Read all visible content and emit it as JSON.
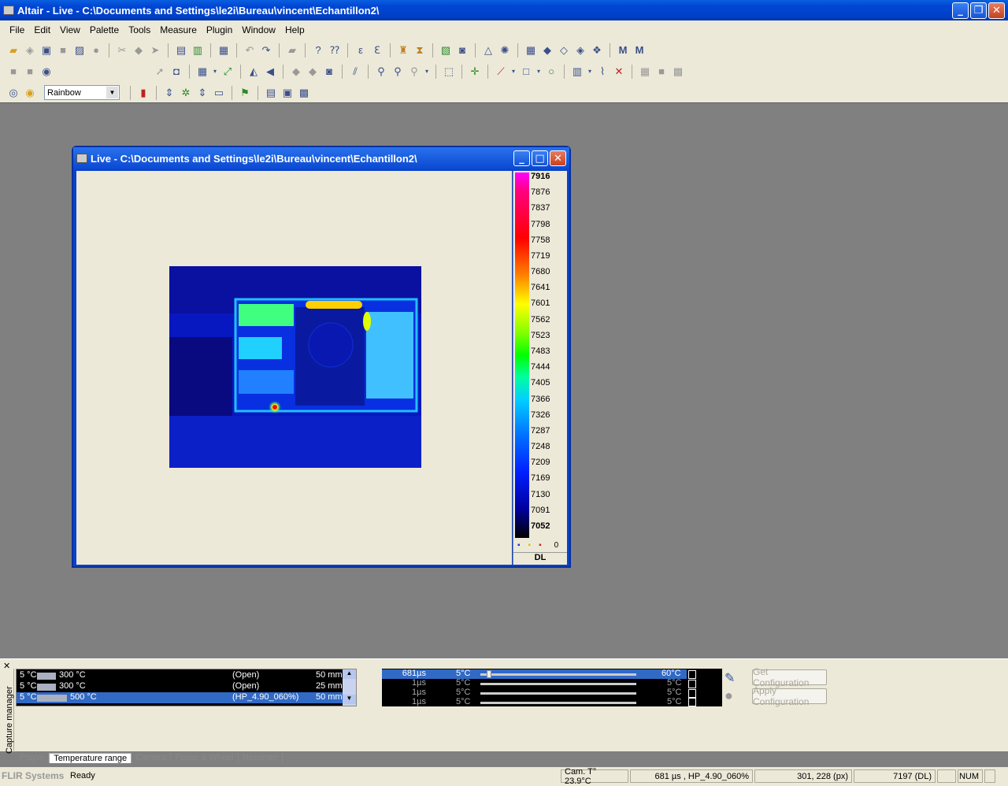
{
  "window": {
    "title": "Altair - Live - C:\\Documents and Settings\\le2i\\Bureau\\vincent\\Echantillon2\\"
  },
  "menu": [
    "File",
    "Edit",
    "View",
    "Palette",
    "Tools",
    "Measure",
    "Plugin",
    "Window",
    "Help"
  ],
  "palette": {
    "selected": "Rainbow"
  },
  "child": {
    "title": "Live - C:\\Documents and Settings\\le2i\\Bureau\\vincent\\Echantillon2\\"
  },
  "scale": {
    "ticks": [
      "7916",
      "7876",
      "7837",
      "7798",
      "7758",
      "7719",
      "7680",
      "7641",
      "7601",
      "7562",
      "7523",
      "7483",
      "7444",
      "7405",
      "7366",
      "7326",
      "7287",
      "7248",
      "7209",
      "7169",
      "7130",
      "7091",
      "7052"
    ],
    "marker_count": "0",
    "unit": "DL"
  },
  "capture": {
    "panel_label": "Capture manager",
    "ranges": [
      {
        "min": "5 °C",
        "max": "300 °C",
        "filter": "(Open)",
        "lens": "50 mm"
      },
      {
        "min": "5 °C",
        "max": "300 °C",
        "filter": "(Open)",
        "lens": "25 mm"
      },
      {
        "min": "5 °C",
        "max": "500 °C",
        "filter": "(HP_4.90_060%)",
        "lens": "50 mm"
      }
    ],
    "camera_rows": [
      {
        "time": "681µs",
        "min": "5°C",
        "max": "60°C"
      },
      {
        "time": "1µs",
        "min": "5°C",
        "max": "5°C"
      },
      {
        "time": "1µs",
        "min": "5°C",
        "max": "5°C"
      },
      {
        "time": "1µs",
        "min": "5°C",
        "max": "5°C"
      }
    ],
    "get_config": "Get Configuration",
    "apply_config": "Apply Configuration",
    "tabs": [
      "Player",
      "Temperature range",
      "Camera",
      "Focus & Wheel",
      "Recorder"
    ]
  },
  "status": {
    "brand": "FLIR Systems",
    "state": "Ready",
    "cam_temp": "Cam. T° 23.9°C",
    "exposure": "681 µs , HP_4.90_060%",
    "pixel": "301, 228 (px)",
    "value": "7197 (DL)",
    "num": "NUM"
  }
}
